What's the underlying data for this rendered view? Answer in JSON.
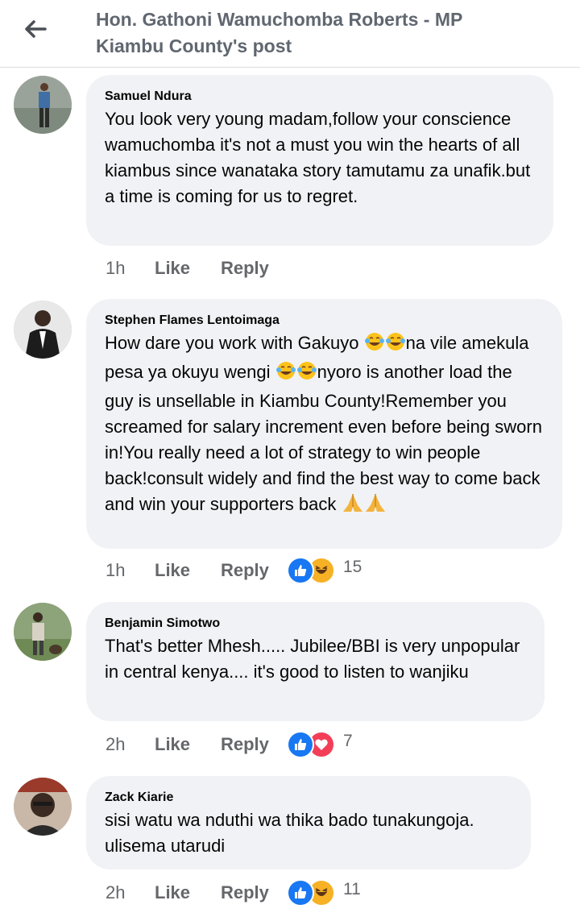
{
  "header": {
    "title_line1": "Hon. Gathoni Wamuchomba Roberts - MP",
    "title_line2": "Kiambu County's post"
  },
  "comments": [
    {
      "author": "Samuel Ndura",
      "text": "You look very young madam,follow your conscience wamuchomba it's not a must you win the hearts of all kiambus since wanataka story tamutamu za unafik.but a time is coming for us to regret.",
      "time": "1h",
      "like_label": "Like",
      "reply_label": "Reply"
    },
    {
      "author": "Stephen Flames Lentoimaga",
      "text_parts": [
        "How dare you work with Gakuyo ",
        "na vile amekula pesa ya okuyu wengi ",
        "nyoro is another load the guy is unsellable in Kiambu County!Remember you screamed for salary increment even before being sworn in!You really need a lot of strategy to win people back!consult widely and find the best way to come back and win your supporters back "
      ],
      "time": "1h",
      "like_label": "Like",
      "reply_label": "Reply",
      "reactions": [
        "like-icon",
        "haha-icon"
      ],
      "reaction_count": "15"
    },
    {
      "author": "Benjamin Simotwo",
      "text": "That's better Mhesh..... Jubilee/BBI is very unpopular in central kenya.... it's good to listen to wanjiku",
      "time": "2h",
      "like_label": "Like",
      "reply_label": "Reply",
      "reactions": [
        "like-icon",
        "love-icon"
      ],
      "reaction_count": "7"
    },
    {
      "author": "Zack Kiarie",
      "text": "sisi watu wa nduthi wa thika bado tunakungoja. ulisema utarudi",
      "time": "2h",
      "like_label": "Like",
      "reply_label": "Reply",
      "reactions": [
        "like-icon",
        "haha-icon"
      ],
      "reaction_count": "11"
    }
  ],
  "colors": {
    "bubble": "#f0f2f5",
    "secondary_text": "#65676b",
    "like_blue": "#1877f2",
    "haha_yellow": "#f7b125",
    "love_red": "#f33e58"
  }
}
